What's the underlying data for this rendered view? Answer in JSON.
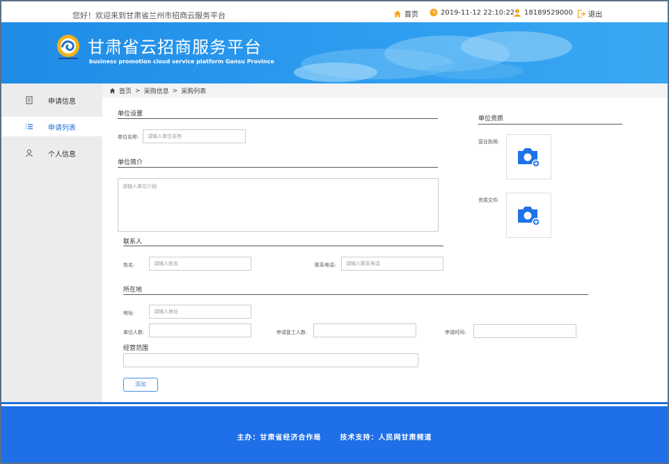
{
  "topbar": {
    "welcome": "您好！欢迎来到甘肃省兰州市招商云服务平台",
    "home": "首页",
    "datetime": "2019-11-12 22:10:22",
    "phone": "18189529000",
    "logout": "退出"
  },
  "banner": {
    "title": "甘肃省云招商服务平台",
    "subtitle": "business promotion cloud service platform  Gansu Province"
  },
  "sidebar": {
    "items": [
      {
        "label": "申请信息",
        "icon": "document-icon"
      },
      {
        "label": "申请列表",
        "icon": "list-icon"
      },
      {
        "label": "个人信息",
        "icon": "user-icon"
      }
    ]
  },
  "breadcrumb": {
    "items": [
      "首页",
      "采购信息",
      "采购列表"
    ],
    "sep": ">"
  },
  "form": {
    "unit_settings": "单位设置",
    "unit_name_label": "单位名称:",
    "unit_name_placeholder": "请输入单位名称",
    "unit_intro": "单位简介",
    "unit_intro_placeholder": "请输入单位介绍",
    "contact": "联系人",
    "name_label": "姓名:",
    "name_placeholder": "请输入姓名",
    "phone_label": "联系电话:",
    "phone_placeholder": "请输入联系电话",
    "location": "所在地",
    "address_label": "地址:",
    "address_placeholder": "请输入地址",
    "headcount_label": "单位人数:",
    "resume_label": "申请复工人数:",
    "apply_time_label": "申请时间:",
    "scope": "经营范围",
    "add": "添加"
  },
  "qualification": {
    "title": "单位资质",
    "license_label": "营业执照:",
    "cert_label": "资质文件:"
  },
  "footer": {
    "host": "主办：甘肃省经济合作局",
    "support": "技术支持：人民网甘肃频道"
  },
  "colors": {
    "primary": "#1e6fe8",
    "accent": "#f5a623"
  }
}
